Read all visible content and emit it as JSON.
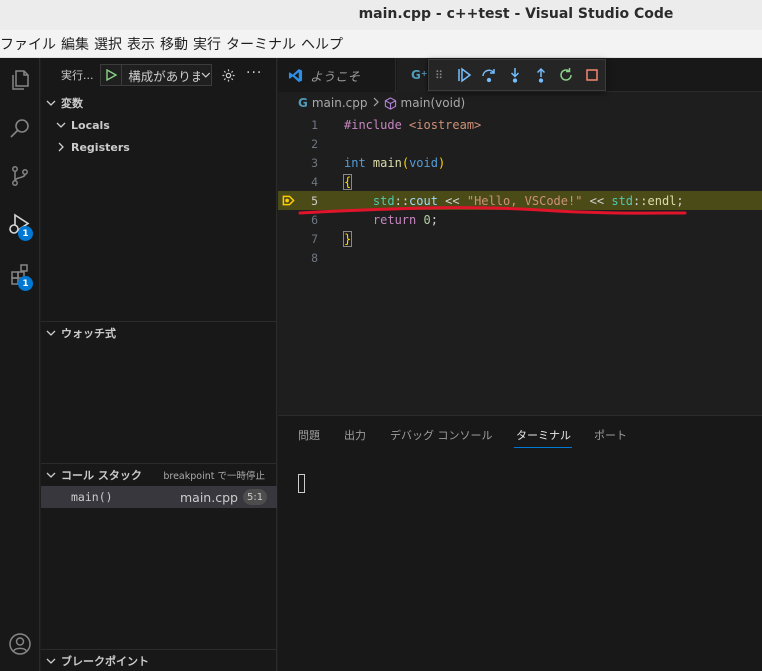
{
  "window": {
    "title": "main.cpp - c++test - Visual Studio Code"
  },
  "menu": [
    "ファイル",
    "編集",
    "選択",
    "表示",
    "移動",
    "実行",
    "ターミナル",
    "ヘルプ"
  ],
  "activity": {
    "items": [
      "explorer-icon",
      "search-icon",
      "source-control-icon",
      "run-debug-icon",
      "extensions-icon",
      "account-icon"
    ],
    "debug_badge": "1",
    "extensions_badge": "1"
  },
  "sidebar": {
    "run_label": "実行...",
    "config": "構成がありま",
    "variables": {
      "header": "変数",
      "scopes": [
        "Locals",
        "Registers"
      ]
    },
    "watch": {
      "header": "ウォッチ式"
    },
    "call_stack": {
      "header": "コール スタック",
      "status": "breakpoint で一時停止",
      "frames": [
        {
          "function": "main()",
          "file": "main.cpp",
          "position": "5:1"
        }
      ]
    },
    "breakpoints": {
      "header": "ブレークポイント"
    }
  },
  "editor": {
    "tabs": [
      {
        "label": "ようこそ"
      }
    ],
    "breadcrumb": {
      "file": "main.cpp",
      "symbol": "main(void)"
    },
    "current_line": 5,
    "line_numbers": [
      "1",
      "2",
      "3",
      "4",
      "5",
      "6",
      "7",
      "8"
    ]
  },
  "panel": {
    "tabs": [
      "問題",
      "出力",
      "デバッグ コンソール",
      "ターミナル",
      "ポート"
    ],
    "active_tab": "ターミナル"
  },
  "colors": {
    "accent": "#0078d4",
    "current_line_bg": "#4b4b18",
    "annotation_red": "#e0142b"
  }
}
